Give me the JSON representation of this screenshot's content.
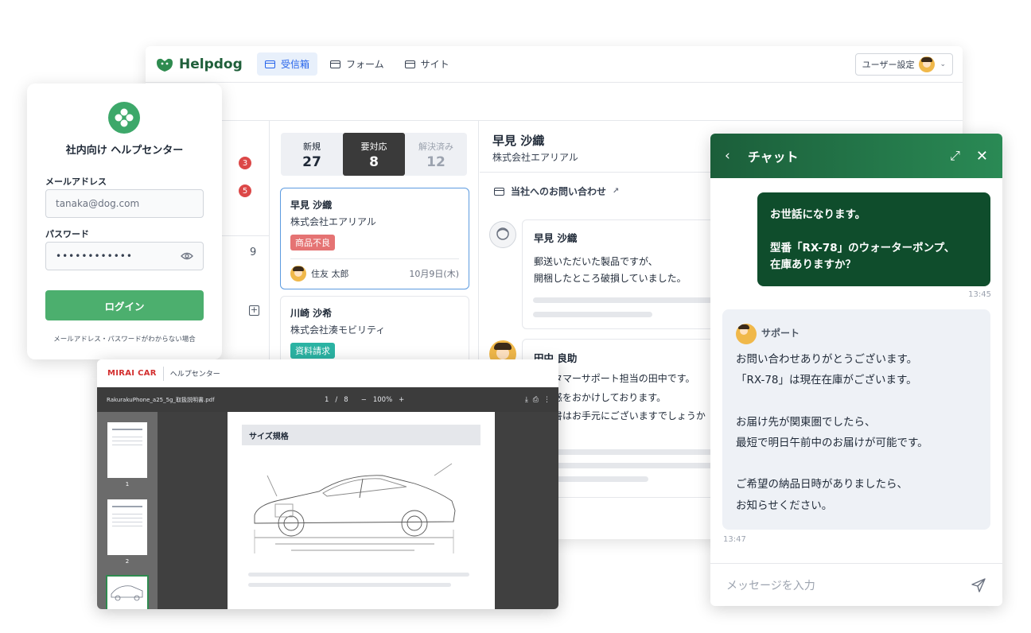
{
  "app": {
    "name": "Helpdog",
    "nav": [
      "受信箱",
      "フォーム",
      "サイト"
    ],
    "user_settings": "ユーザー設定"
  },
  "sidebar": {
    "badge1": "3",
    "badge2": "5",
    "count": "9"
  },
  "status_tabs": [
    {
      "label": "新規",
      "count": "27"
    },
    {
      "label": "要対応",
      "count": "8"
    },
    {
      "label": "解決済み",
      "count": "12"
    }
  ],
  "tickets": [
    {
      "name": "早見 沙織",
      "company": "株式会社エアリアル",
      "tag": "商品不良",
      "assignee": "住友 太郎",
      "date": "10月9日(木)"
    },
    {
      "name": "川崎 沙希",
      "company": "株式会社湊モビリティ",
      "tag": "資料請求"
    }
  ],
  "detail": {
    "name": "早見 沙織",
    "company": "株式会社エアリアル",
    "inquiry": "当社へのお問い合わせ",
    "msg1_name": "早見 沙織",
    "msg1_line1": "郵送いただいた製品ですが、",
    "msg1_line2": "開梱したところ破損していました。",
    "msg2_name": "田中 良助",
    "msg2_line1": "カスタマーサポート担当の田中です。",
    "msg2_line2": "ご迷惑をおかけしております。",
    "msg2_line3": "保証書はお手元にございますでしょうか"
  },
  "login": {
    "title": "社内向け ヘルプセンター",
    "email_label": "メールアドレス",
    "email_value": "tanaka@dog.com",
    "password_label": "パスワード",
    "password_value": "••••••••••••",
    "login_button": "ログイン",
    "forgot": "メールアドレス・パスワードがわからない場合"
  },
  "pdf": {
    "brand": "MIRAI CAR",
    "section": "ヘルプセンター",
    "filename": "RakurakuPhone_a25_5g_取扱説明書.pdf",
    "page_current": "1",
    "page_total": "8",
    "zoom": "100%",
    "heading": "サイズ規格",
    "thumbs": [
      "1",
      "2"
    ]
  },
  "chat": {
    "title": "チャット",
    "out_line1": "お世話になります。",
    "out_line2": "型番「RX-78」のウォーターポンプ、",
    "out_line3": "在庫ありますか？",
    "out_time": "13:45",
    "agent": "サポート",
    "in_lines": [
      "お問い合わせありがとうございます。",
      "「RX-78」は現在在庫がございます。",
      "",
      "お届け先が関東圏でしたら、",
      "最短で明日午前中のお届けが可能です。",
      "",
      "ご希望の納品日時がありましたら、",
      "お知らせください。"
    ],
    "in_time": "13:47",
    "placeholder": "メッセージを入力"
  },
  "colors": {
    "brand_green": "#1f5f3a",
    "accent_blue": "#2563eb",
    "login_green": "#4caf6e",
    "tag_red": "#e57373",
    "tag_teal": "#2bb3a3",
    "mirai_red": "#d32f2f"
  }
}
